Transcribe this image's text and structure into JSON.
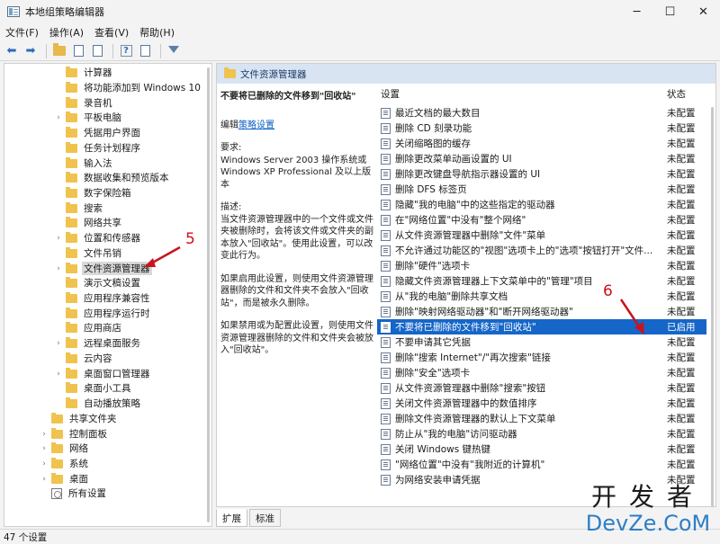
{
  "window": {
    "title": "本地组策略编辑器",
    "buttons": [
      "─",
      "☐",
      "✕"
    ]
  },
  "menu": [
    "文件(F)",
    "操作(A)",
    "查看(V)",
    "帮助(H)"
  ],
  "toolbar": {
    "icons": [
      "back-arrow-icon",
      "forward-arrow-icon",
      "folder-up-icon",
      "show-hide-tree-icon",
      "export-list-icon",
      "help-icon",
      "properties-icon",
      "filter-icon"
    ]
  },
  "tree": {
    "items": [
      {
        "label": "计算器",
        "expander": ""
      },
      {
        "label": "将功能添加到 Windows 10",
        "expander": ""
      },
      {
        "label": "录音机",
        "expander": ""
      },
      {
        "label": "平板电脑",
        "expander": "›"
      },
      {
        "label": "凭据用户界面",
        "expander": ""
      },
      {
        "label": "任务计划程序",
        "expander": ""
      },
      {
        "label": "输入法",
        "expander": ""
      },
      {
        "label": "数据收集和预览版本",
        "expander": ""
      },
      {
        "label": "数字保险箱",
        "expander": ""
      },
      {
        "label": "搜索",
        "expander": ""
      },
      {
        "label": "网络共享",
        "expander": ""
      },
      {
        "label": "位置和传感器",
        "expander": "›"
      },
      {
        "label": "文件吊销",
        "expander": ""
      },
      {
        "label": "文件资源管理器",
        "expander": "›"
      },
      {
        "label": "演示文稿设置",
        "expander": ""
      },
      {
        "label": "应用程序兼容性",
        "expander": ""
      },
      {
        "label": "应用程序运行时",
        "expander": ""
      },
      {
        "label": "应用商店",
        "expander": ""
      },
      {
        "label": "远程桌面服务",
        "expander": "›"
      },
      {
        "label": "云内容",
        "expander": ""
      },
      {
        "label": "桌面窗口管理器",
        "expander": "›"
      },
      {
        "label": "桌面小工具",
        "expander": ""
      },
      {
        "label": "自动播放策略",
        "expander": ""
      },
      {
        "label": "共享文件夹",
        "expander": ""
      },
      {
        "label": "控制面板",
        "expander": "›"
      },
      {
        "label": "网络",
        "expander": "›"
      },
      {
        "label": "系统",
        "expander": "›"
      },
      {
        "label": "桌面",
        "expander": "›"
      },
      {
        "label": "所有设置",
        "expander": ""
      }
    ],
    "selected": "文件资源管理器"
  },
  "right": {
    "header": "文件资源管理器",
    "description": {
      "title": "不要将已删除的文件移到\"回收站\"",
      "edit_prefix": "编辑",
      "edit_link": "策略设置",
      "requirements_label": "要求:",
      "requirements_text": "Windows Server 2003 操作系统或 Windows XP Professional 及以上版本",
      "desc_label": "描述:",
      "desc_text": "当文件资源管理器中的一个文件或文件夹被删除时，会将该文件或文件夹的副本放入\"回收站\"。使用此设置，可以改变此行为。",
      "enabled_text": "如果启用此设置，则使用文件资源管理器删除的文件和文件夹不会放入\"回收站\"，而是被永久删除。",
      "disabled_text": "如果禁用或为配置此设置，则使用文件资源管理器删除的文件和文件夹会被放入\"回收站\"。"
    },
    "columns": {
      "setting": "设置",
      "status": "状态"
    },
    "rows": [
      {
        "name": "最近文档的最大数目",
        "status": "未配置"
      },
      {
        "name": "删除 CD 刻录功能",
        "status": "未配置"
      },
      {
        "name": "关闭缩略图的缓存",
        "status": "未配置"
      },
      {
        "name": "删除更改菜单动画设置的 UI",
        "status": "未配置"
      },
      {
        "name": "删除更改键盘导航指示器设置的 UI",
        "status": "未配置"
      },
      {
        "name": "删除 DFS 标签页",
        "status": "未配置"
      },
      {
        "name": "隐藏\"我的电脑\"中的这些指定的驱动器",
        "status": "未配置"
      },
      {
        "name": "在\"网络位置\"中没有\"整个网络\"",
        "status": "未配置"
      },
      {
        "name": "从文件资源管理器中删除\"文件\"菜单",
        "status": "未配置"
      },
      {
        "name": "不允许通过功能区的\"视图\"选项卡上的\"选项\"按钮打开\"文件...",
        "status": "未配置"
      },
      {
        "name": "删除\"硬件\"选项卡",
        "status": "未配置"
      },
      {
        "name": "隐藏文件资源管理器上下文菜单中的\"管理\"项目",
        "status": "未配置"
      },
      {
        "name": "从\"我的电脑\"删除共享文档",
        "status": "未配置"
      },
      {
        "name": "删除\"映射网络驱动器\"和\"断开网络驱动器\"",
        "status": "未配置"
      },
      {
        "name": "不要将已删除的文件移到\"回收站\"",
        "status": "已启用"
      },
      {
        "name": "不要申请其它凭据",
        "status": "未配置"
      },
      {
        "name": "删除\"搜索 Internet\"/\"再次搜索\"链接",
        "status": "未配置"
      },
      {
        "name": "删除\"安全\"选项卡",
        "status": "未配置"
      },
      {
        "name": "从文件资源管理器中删除\"搜索\"按钮",
        "status": "未配置"
      },
      {
        "name": "关闭文件资源管理器中的数值排序",
        "status": "未配置"
      },
      {
        "name": "删除文件资源管理器的默认上下文菜单",
        "status": "未配置"
      },
      {
        "name": "防止从\"我的电脑\"访问驱动器",
        "status": "未配置"
      },
      {
        "name": "关闭 Windows 键热键",
        "status": "未配置"
      },
      {
        "name": "\"网络位置\"中没有\"我附近的计算机\"",
        "status": "未配置"
      },
      {
        "name": "为网络安装申请凭据",
        "status": "未配置"
      }
    ],
    "highlighted": "不要将已删除的文件移到\"回收站\""
  },
  "tabs": [
    "扩展",
    "标准"
  ],
  "statusbar": "47 个设置",
  "annotations": {
    "step5": "5",
    "step6": "6",
    "color": "#c8141e"
  },
  "watermark": {
    "cn": "开发者",
    "en": "DevZe.CoM"
  }
}
